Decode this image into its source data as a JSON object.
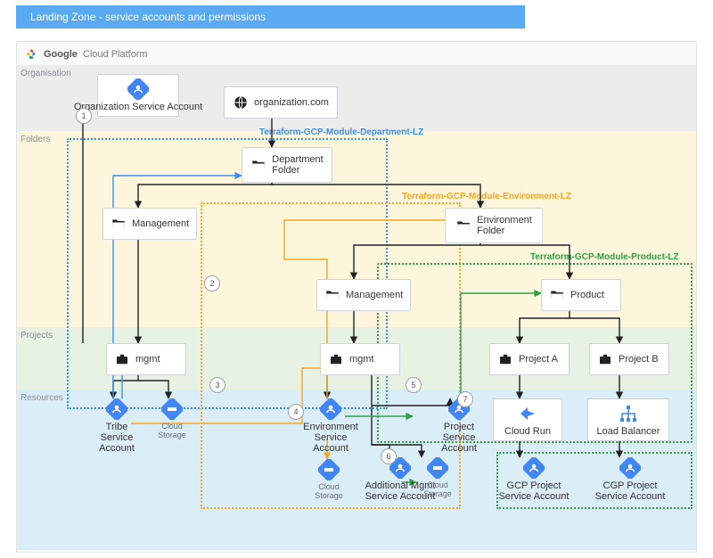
{
  "title": "Landing Zone - service accounts and permissions",
  "platform": {
    "brand": "Google",
    "product": "Cloud Platform"
  },
  "bands": {
    "organisation": "Organisation",
    "folders": "Folders",
    "projects": "Projects",
    "resources": "Resources"
  },
  "modules": {
    "department": "Terraform-GCP-Module-Department-LZ",
    "environment": "Terraform-GCP-Module-Environment-LZ",
    "product": "Terraform-GCP-Module-Product-LZ"
  },
  "nodes": {
    "org_sa": "Organization\nService Account",
    "organization": "organization.com",
    "dept_folder": "Department\nFolder",
    "management_l": "Management",
    "env_folder": "Environment\nFolder",
    "management_r": "Management",
    "product_folder": "Product",
    "mgmt_l": "mgmt",
    "mgmt_r": "mgmt",
    "project_a": "Project A",
    "project_b": "Project B",
    "tribe_sa": "Tribe\nService Account",
    "cloud_storage_l": "Cloud\nStorage",
    "env_sa": "Environment\nService Account",
    "cloud_storage_m": "Cloud\nStorage",
    "add_mgmt_sa": "Additional Mgmt\nService Account",
    "cloud_storage_r": "Cloud\nStorage",
    "project_sa": "Project\nService Account",
    "cloud_run": "Cloud Run",
    "load_balancer": "Load Balancer",
    "gcp_proj_sa": "GCP Project\nService Account",
    "cgp_proj_sa": "CGP Project\nService Account"
  },
  "steps": {
    "s1": "1",
    "s2": "2",
    "s3": "3",
    "s4": "4",
    "s5": "5",
    "s6": "6",
    "s7": "7"
  },
  "colors": {
    "blue": "#3b8eea",
    "orange": "#f5a623",
    "green": "#2e9e47",
    "gcp_blue": "#4285f4"
  }
}
